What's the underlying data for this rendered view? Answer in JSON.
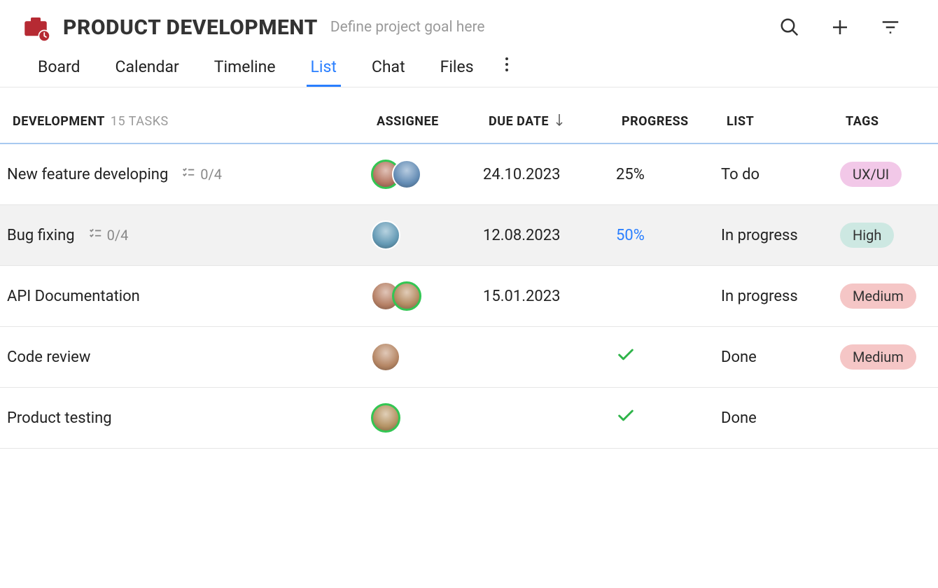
{
  "header": {
    "title": "PRODUCT DEVELOPMENT",
    "goal_placeholder": "Define project goal here"
  },
  "tabs": {
    "items": [
      "Board",
      "Calendar",
      "Timeline",
      "List",
      "Chat",
      "Files"
    ],
    "active_index": 3
  },
  "columns": {
    "group": "DEVELOPMENT",
    "task_count": "15 TASKS",
    "assignee": "ASSIGNEE",
    "due": "DUE DATE",
    "progress": "PROGRESS",
    "list": "LIST",
    "tags": "TAGS"
  },
  "tasks": [
    {
      "title": "New feature developing",
      "subtask": "0/4",
      "assignees": [
        {
          "online": true,
          "hue": 15
        },
        {
          "online": false,
          "hue": 210
        }
      ],
      "due": "24.10.2023",
      "progress": "25%",
      "progress_highlight": false,
      "done": false,
      "list": "To do",
      "tag": {
        "label": "UX/UI",
        "class": "uxui"
      },
      "highlighted": false
    },
    {
      "title": "Bug fixing",
      "subtask": "0/4",
      "assignees": [
        {
          "online": false,
          "hue": 200
        }
      ],
      "due": "12.08.2023",
      "progress": "50%",
      "progress_highlight": true,
      "done": false,
      "list": "In progress",
      "tag": {
        "label": "High",
        "class": "high"
      },
      "highlighted": true
    },
    {
      "title": "API Documentation",
      "subtask": null,
      "assignees": [
        {
          "online": false,
          "hue": 20
        },
        {
          "online": true,
          "hue": 30
        }
      ],
      "due": "15.01.2023",
      "progress": "",
      "progress_highlight": false,
      "done": false,
      "list": "In progress",
      "tag": {
        "label": "Medium",
        "class": "medium"
      },
      "highlighted": false
    },
    {
      "title": "Code review",
      "subtask": null,
      "assignees": [
        {
          "online": false,
          "hue": 25
        }
      ],
      "due": "",
      "progress": "",
      "progress_highlight": false,
      "done": true,
      "list": "Done",
      "tag": {
        "label": "Medium",
        "class": "medium"
      },
      "highlighted": false
    },
    {
      "title": "Product testing",
      "subtask": null,
      "assignees": [
        {
          "online": true,
          "hue": 35
        }
      ],
      "due": "",
      "progress": "",
      "progress_highlight": false,
      "done": true,
      "list": "Done",
      "tag": null,
      "highlighted": false
    }
  ]
}
